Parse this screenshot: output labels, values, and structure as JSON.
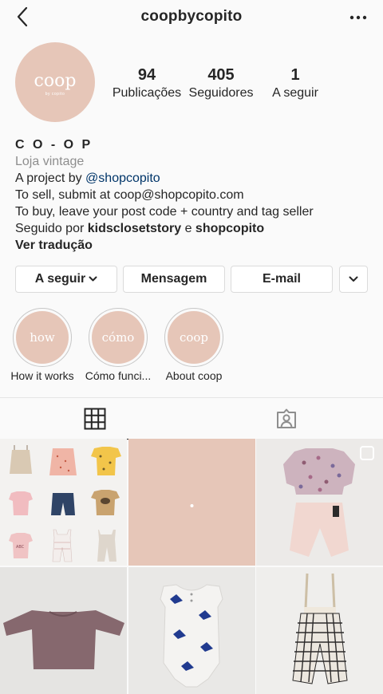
{
  "header": {
    "username": "coopbycopito"
  },
  "profile": {
    "avatar_text": "coop",
    "avatar_subtext": "by copito",
    "stats": [
      {
        "value": "94",
        "label": "Publicações"
      },
      {
        "value": "405",
        "label": "Seguidores"
      },
      {
        "value": "1",
        "label": "A seguir"
      }
    ]
  },
  "bio": {
    "name": "C O - O P",
    "category": "Loja vintage",
    "line1_prefix": "A project by ",
    "line1_mention": "@shopcopito",
    "line2": "To sell, submit at coop@shopcopito.com",
    "line3": "To buy, leave your post code + country and tag seller",
    "followed_prefix": "Seguido por ",
    "followed_user1": "kidsclosetstory",
    "followed_joiner": " e ",
    "followed_user2": "shopcopito",
    "translate": "Ver tradução"
  },
  "actions": {
    "following": "A seguir",
    "message": "Mensagem",
    "email": "E-mail"
  },
  "highlights": [
    {
      "cover": "how",
      "caption": "How it works"
    },
    {
      "cover": "cómo",
      "caption": "Cómo funci..."
    },
    {
      "cover": "coop",
      "caption": "About coop"
    }
  ],
  "colors": {
    "brand_pink": "#e6c6b8",
    "mention_blue": "#003569",
    "secondary_text": "#8e8e8e"
  }
}
